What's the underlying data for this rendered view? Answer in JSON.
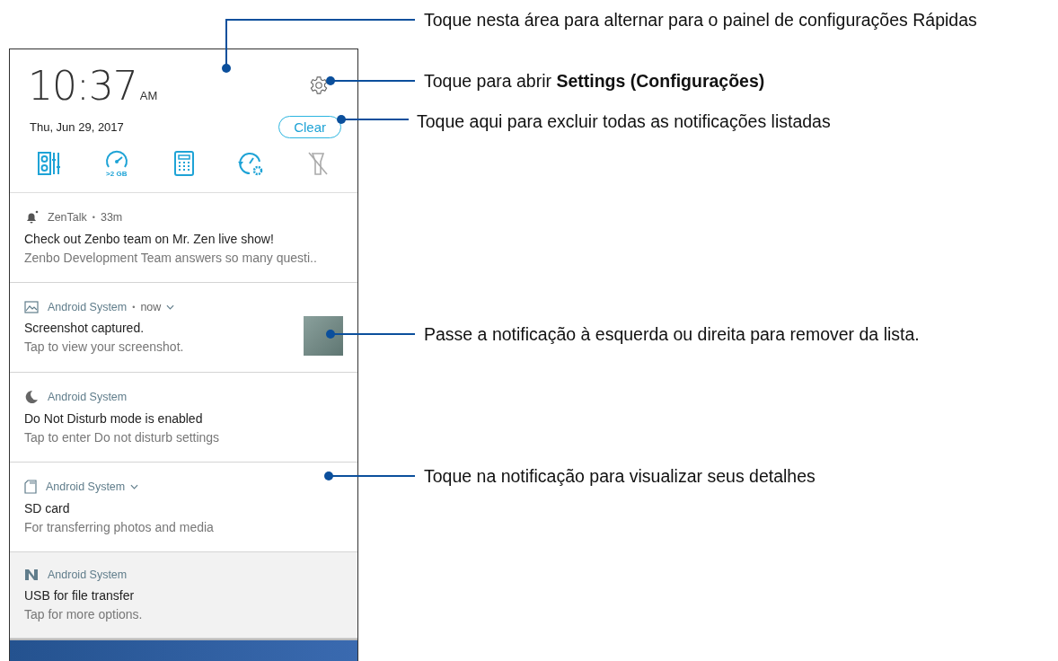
{
  "header": {
    "time": "10:37",
    "ampm": "AM",
    "date": "Thu, Jun 29, 2017",
    "clear_button": "Clear"
  },
  "quick_settings": [
    {
      "disabled": false
    },
    {
      "caption": ">2 GB",
      "disabled": false
    },
    {
      "disabled": false
    },
    {
      "disabled": false
    },
    {
      "disabled": true
    }
  ],
  "notifications": [
    {
      "app": "ZenTalk",
      "separator": "•",
      "time": "33m",
      "expandable": false,
      "title": "Check out Zenbo team on Mr. Zen live show!",
      "text": "Zenbo Development Team answers so many questi..",
      "thumbnail": false,
      "kind": "normal"
    },
    {
      "app": "Android System",
      "separator": "•",
      "time": "now",
      "expandable": true,
      "title": "Screenshot captured.",
      "text": "Tap to view your screenshot.",
      "thumbnail": true,
      "kind": "normal"
    },
    {
      "app": "Android System",
      "expandable": false,
      "title": "Do Not Disturb mode is enabled",
      "text": "Tap to enter Do not disturb settings",
      "thumbnail": false,
      "kind": "normal"
    },
    {
      "app": "Android System",
      "expandable": true,
      "title": "SD card",
      "text": "For transferring photos and media",
      "thumbnail": false,
      "kind": "normal"
    },
    {
      "app": "Android System",
      "expandable": false,
      "title": "USB for file transfer",
      "text": "Tap for more options.",
      "thumbnail": false,
      "kind": "ongoing"
    }
  ],
  "callouts": [
    {
      "text": "Toque nesta área para alternar para o painel de configurações Rápidas"
    },
    {
      "text": "Toque para abrir **Settings (Configurações)**"
    },
    {
      "text": "Toque aqui para excluir todas as notificações listadas"
    },
    {
      "text": "Passe a notificação à esquerda ou direita para remover da lista."
    },
    {
      "text": "Toque na notificação para visualizar seus detalhes"
    }
  ]
}
